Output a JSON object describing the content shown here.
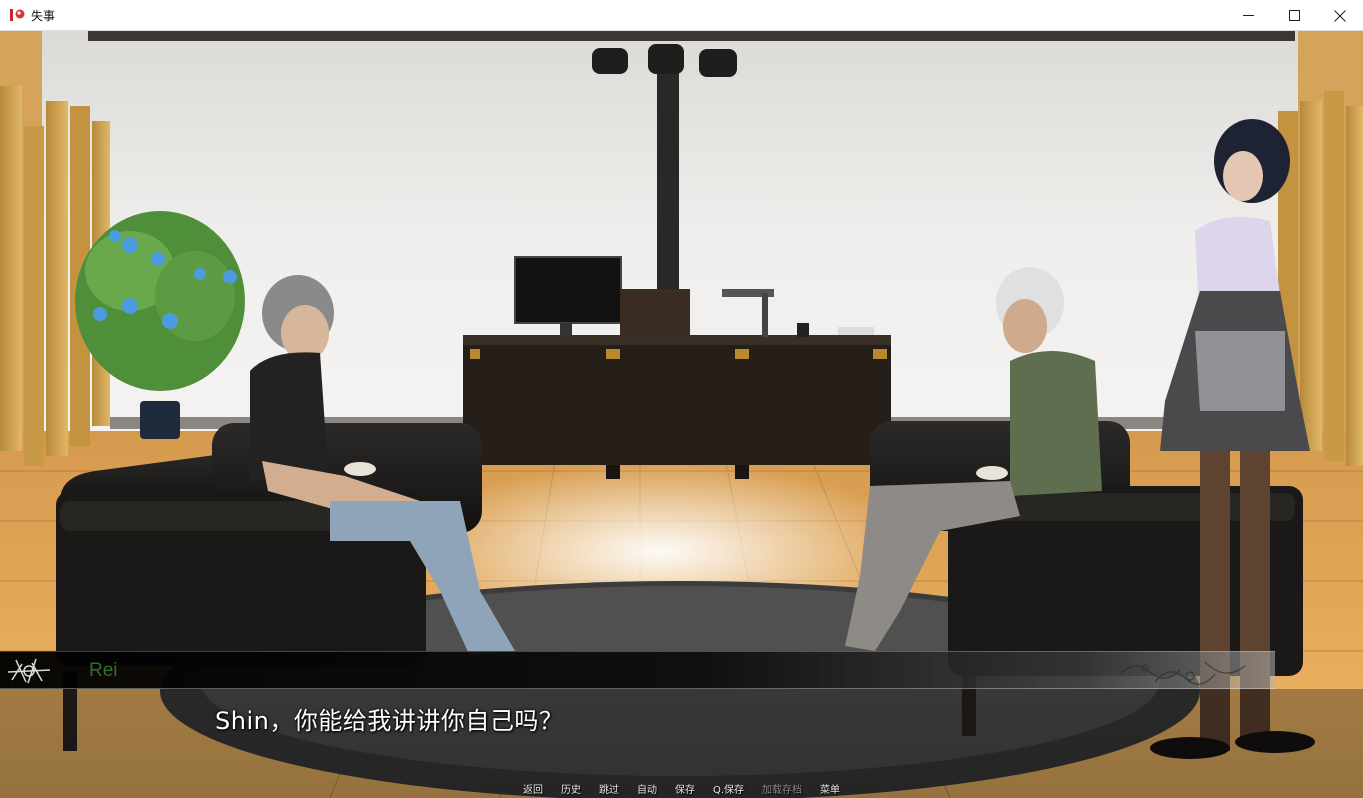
{
  "window": {
    "title": "失事",
    "controls": {
      "minimize_icon": "minimize-icon",
      "maximize_icon": "maximize-icon",
      "close_icon": "close-icon"
    }
  },
  "dialogue": {
    "speaker": "Rei",
    "speaker_color": "#2f6f2a",
    "text": "Shin，你能给我讲讲你自己吗？"
  },
  "quick_menu": [
    {
      "label": "返回",
      "enabled": true
    },
    {
      "label": "历史",
      "enabled": true
    },
    {
      "label": "跳过",
      "enabled": true
    },
    {
      "label": "自动",
      "enabled": true
    },
    {
      "label": "保存",
      "enabled": true
    },
    {
      "label": "Q.保存",
      "enabled": true
    },
    {
      "label": "加载存档",
      "enabled": false
    },
    {
      "label": "菜单",
      "enabled": true
    }
  ],
  "colors": {
    "wall": "#e9e7e4",
    "floor": "#e0a85a",
    "sofa": "#1c1a19",
    "accent_text": "#ffffff"
  }
}
